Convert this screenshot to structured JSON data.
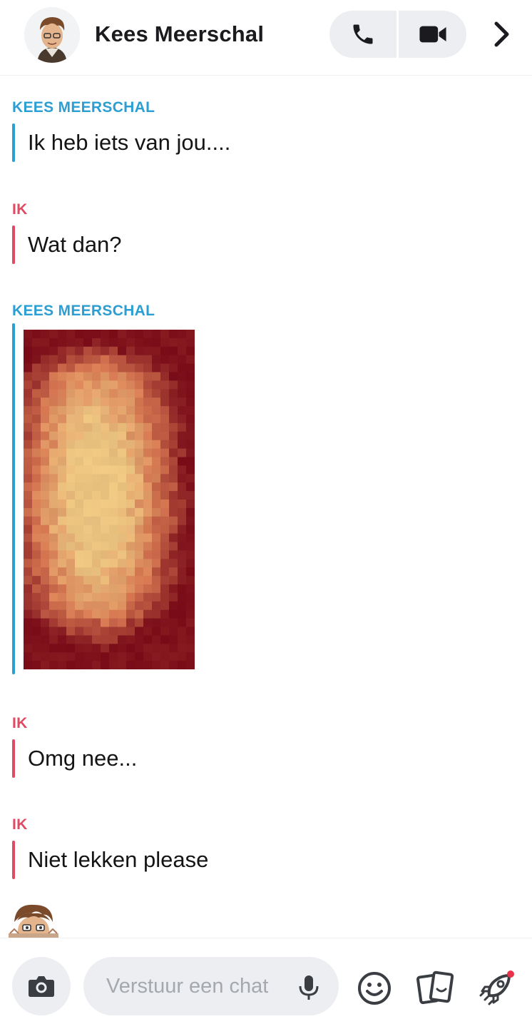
{
  "header": {
    "contact_name": "Kees Meerschal",
    "avatar_icon": "bitmoji-avatar-icon",
    "voice_call_icon": "phone-icon",
    "video_call_icon": "video-camera-icon",
    "more_icon": "chevron-right-icon"
  },
  "messages": [
    {
      "sender": "KEES MEERSCHAL",
      "from": "them",
      "text": "Ik heb iets van jou...."
    },
    {
      "sender": "IK",
      "from": "me",
      "text": "Wat dan?"
    },
    {
      "sender": "KEES MEERSCHAL",
      "from": "them",
      "type": "photo"
    },
    {
      "sender": "IK",
      "from": "me",
      "text": "Omg nee..."
    },
    {
      "sender": "IK",
      "from": "me",
      "text": "Niet lekken please"
    }
  ],
  "composer": {
    "placeholder": "Verstuur een chat",
    "camera_icon": "camera-icon",
    "mic_icon": "microphone-icon",
    "emoji_icon": "smiley-icon",
    "stickers_icon": "cards-icon",
    "games_icon": "rocket-icon"
  },
  "colors": {
    "them": "#2b9fd3",
    "me": "#e04a63",
    "notification_dot": "#e8334a"
  }
}
